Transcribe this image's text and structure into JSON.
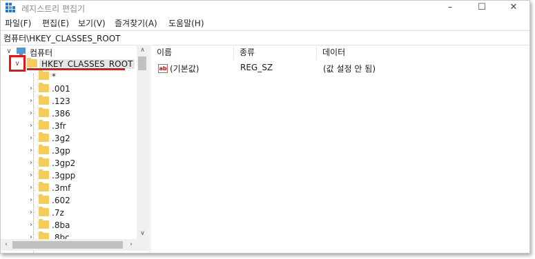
{
  "window": {
    "title": "레지스트리 편집기"
  },
  "menu": [
    "파일(F)",
    "편집(E)",
    "보기(V)",
    "즐겨찾기(A)",
    "도움말(H)"
  ],
  "address": "컴퓨터\\HKEY_CLASSES_ROOT",
  "tree": {
    "root": "컴퓨터",
    "selected": "HKEY_CLASSES_ROOT",
    "children": [
      "*",
      ".001",
      ".123",
      ".386",
      ".3fr",
      ".3g2",
      ".3gp",
      ".3gp2",
      ".3gpp",
      ".3mf",
      ".602",
      ".7z",
      ".8ba",
      ".8bc"
    ]
  },
  "list": {
    "columns": [
      "이름",
      "종류",
      "데이터"
    ],
    "rows": [
      {
        "name": "(기본값)",
        "type": "REG_SZ",
        "data": "(값 설정 안 됨)"
      }
    ]
  },
  "colors": {
    "folder": "#f5cc5a",
    "highlight": "#e5e5e5",
    "annotation_red": "#e11111"
  }
}
